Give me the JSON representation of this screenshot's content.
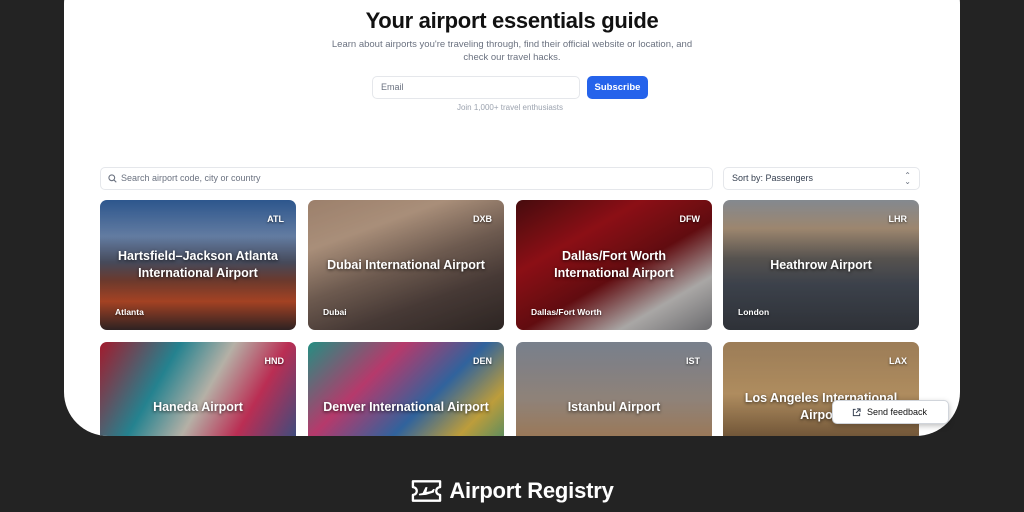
{
  "hero": {
    "title": "Your airport essentials guide",
    "subtitle": "Learn about airports you're traveling through, find their official website or location, and check our travel hacks.",
    "email_placeholder": "Email",
    "subscribe_label": "Subscribe",
    "caption": "Join 1,000+ travel enthusiasts"
  },
  "search": {
    "placeholder": "Search airport code, city or country"
  },
  "sort": {
    "label": "Sort by: Passengers"
  },
  "airports": [
    {
      "code": "ATL",
      "name": "Hartsfield–Jackson Atlanta International Airport",
      "city": "Atlanta"
    },
    {
      "code": "DXB",
      "name": "Dubai International Airport",
      "city": "Dubai"
    },
    {
      "code": "DFW",
      "name": "Dallas/Fort Worth International Airport",
      "city": "Dallas/Fort Worth"
    },
    {
      "code": "LHR",
      "name": "Heathrow Airport",
      "city": "London"
    },
    {
      "code": "HND",
      "name": "Haneda Airport",
      "city": ""
    },
    {
      "code": "DEN",
      "name": "Denver International Airport",
      "city": ""
    },
    {
      "code": "IST",
      "name": "Istanbul Airport",
      "city": ""
    },
    {
      "code": "LAX",
      "name": "Los Angeles International Airport",
      "city": ""
    }
  ],
  "feedback": {
    "label": "Send feedback"
  },
  "brand": {
    "name": "Airport Registry"
  },
  "colors": {
    "accent": "#2563eb",
    "background": "#232323",
    "panel": "#ffffff"
  }
}
